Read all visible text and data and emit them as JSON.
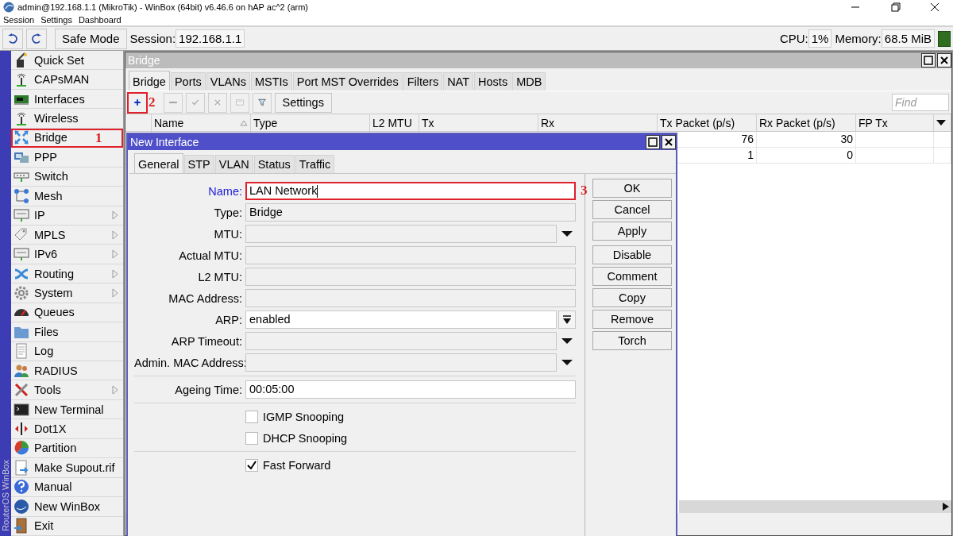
{
  "window": {
    "title": "admin@192.168.1.1 (MikroTik) - WinBox (64bit) v6.46.6 on hAP ac^2 (arm)"
  },
  "menu": [
    "Session",
    "Settings",
    "Dashboard"
  ],
  "toolbar": {
    "safe_mode": "Safe Mode",
    "session_label": "Session:",
    "session": "192.168.1.1",
    "cpu_label": "CPU:",
    "cpu": "1%",
    "memory_label": "Memory:",
    "memory": "68.5 MiB"
  },
  "sidebar": {
    "brand": "RouterOS WinBox",
    "items": [
      {
        "label": "Quick Set",
        "has_submenu": false,
        "highlighted": false
      },
      {
        "label": "CAPsMAN",
        "has_submenu": false,
        "highlighted": false
      },
      {
        "label": "Interfaces",
        "has_submenu": false,
        "highlighted": false
      },
      {
        "label": "Wireless",
        "has_submenu": false,
        "highlighted": false
      },
      {
        "label": "Bridge",
        "has_submenu": false,
        "highlighted": true,
        "annotation": "1"
      },
      {
        "label": "PPP",
        "has_submenu": false,
        "highlighted": false
      },
      {
        "label": "Switch",
        "has_submenu": false,
        "highlighted": false
      },
      {
        "label": "Mesh",
        "has_submenu": false,
        "highlighted": false
      },
      {
        "label": "IP",
        "has_submenu": true,
        "highlighted": false
      },
      {
        "label": "MPLS",
        "has_submenu": true,
        "highlighted": false
      },
      {
        "label": "IPv6",
        "has_submenu": true,
        "highlighted": false
      },
      {
        "label": "Routing",
        "has_submenu": true,
        "highlighted": false
      },
      {
        "label": "System",
        "has_submenu": true,
        "highlighted": false
      },
      {
        "label": "Queues",
        "has_submenu": false,
        "highlighted": false
      },
      {
        "label": "Files",
        "has_submenu": false,
        "highlighted": false
      },
      {
        "label": "Log",
        "has_submenu": false,
        "highlighted": false
      },
      {
        "label": "RADIUS",
        "has_submenu": false,
        "highlighted": false
      },
      {
        "label": "Tools",
        "has_submenu": true,
        "highlighted": false
      },
      {
        "label": "New Terminal",
        "has_submenu": false,
        "highlighted": false
      },
      {
        "label": "Dot1X",
        "has_submenu": false,
        "highlighted": false
      },
      {
        "label": "Partition",
        "has_submenu": false,
        "highlighted": false
      },
      {
        "label": "Make Supout.rif",
        "has_submenu": false,
        "highlighted": false
      },
      {
        "label": "Manual",
        "has_submenu": false,
        "highlighted": false
      },
      {
        "label": "New WinBox",
        "has_submenu": false,
        "highlighted": false
      },
      {
        "label": "Exit",
        "has_submenu": false,
        "highlighted": false
      }
    ]
  },
  "bridge_window": {
    "title": "Bridge",
    "tabs": [
      {
        "label": "Bridge",
        "selected": true
      },
      {
        "label": "Ports",
        "selected": false
      },
      {
        "label": "VLANs",
        "selected": false
      },
      {
        "label": "MSTIs",
        "selected": false
      },
      {
        "label": "Port MST Overrides",
        "selected": false
      },
      {
        "label": "Filters",
        "selected": false
      },
      {
        "label": "NAT",
        "selected": false
      },
      {
        "label": "Hosts",
        "selected": false
      },
      {
        "label": "MDB",
        "selected": false
      }
    ],
    "toolbar": [
      {
        "kind": "add",
        "disabled": false,
        "highlighted": true,
        "annotation": "2"
      },
      {
        "kind": "remove",
        "disabled": true,
        "highlighted": false
      },
      {
        "kind": "enable",
        "disabled": true,
        "highlighted": false
      },
      {
        "kind": "disable",
        "disabled": true,
        "highlighted": false
      },
      {
        "kind": "comment",
        "disabled": true,
        "highlighted": false
      },
      {
        "kind": "filter",
        "disabled": false,
        "highlighted": false
      },
      {
        "kind": "text",
        "label": "Settings",
        "disabled": false,
        "highlighted": false
      }
    ],
    "find": {
      "placeholder": "Find"
    },
    "table": {
      "columns": [
        "Name",
        "Type",
        "L2 MTU",
        "Tx",
        "Rx",
        "Tx Packet (p/s)",
        "Rx Packet (p/s)",
        "FP Tx"
      ],
      "rows": [
        {
          "tx_packet": "76",
          "rx_packet": "30"
        },
        {
          "tx_packet": "1",
          "rx_packet": "0"
        }
      ]
    }
  },
  "dialog": {
    "title": "New Interface",
    "tabs": [
      {
        "label": "General",
        "selected": true
      },
      {
        "label": "STP",
        "selected": false
      },
      {
        "label": "VLAN",
        "selected": false
      },
      {
        "label": "Status",
        "selected": false
      },
      {
        "label": "Traffic",
        "selected": false
      }
    ],
    "form": [
      {
        "kind": "field",
        "label": "Name:",
        "value": "LAN Network",
        "editable": true,
        "focused": true,
        "has_dropdown": false,
        "has_select_button": false,
        "highlighted": true,
        "annotation": "3"
      },
      {
        "kind": "field",
        "label": "Type:",
        "value": "Bridge",
        "editable": false,
        "focused": false,
        "has_dropdown": false,
        "has_select_button": false,
        "highlighted": false
      },
      {
        "kind": "field",
        "label": "MTU:",
        "editable": false,
        "focused": false,
        "has_dropdown": true,
        "has_select_button": false,
        "highlighted": false
      },
      {
        "kind": "field",
        "label": "Actual MTU:",
        "editable": false,
        "focused": false,
        "has_dropdown": false,
        "has_select_button": false,
        "highlighted": false
      },
      {
        "kind": "field",
        "label": "L2 MTU:",
        "editable": false,
        "focused": false,
        "has_dropdown": false,
        "has_select_button": false,
        "highlighted": false
      },
      {
        "kind": "field",
        "label": "MAC Address:",
        "editable": false,
        "focused": false,
        "has_dropdown": false,
        "has_select_button": false,
        "highlighted": false
      },
      {
        "kind": "field",
        "label": "ARP:",
        "value": "enabled",
        "editable": true,
        "focused": false,
        "has_dropdown": false,
        "has_select_button": true,
        "highlighted": false
      },
      {
        "kind": "field",
        "label": "ARP Timeout:",
        "editable": false,
        "focused": false,
        "has_dropdown": true,
        "has_select_button": false,
        "highlighted": false
      },
      {
        "kind": "field",
        "label": "Admin. MAC Address:",
        "editable": false,
        "focused": false,
        "has_dropdown": true,
        "has_select_button": false,
        "highlighted": false
      },
      {
        "kind": "separator"
      },
      {
        "kind": "field",
        "label": "Ageing Time:",
        "value": "00:05:00",
        "editable": true,
        "focused": false,
        "has_dropdown": false,
        "has_select_button": false,
        "highlighted": false
      },
      {
        "kind": "separator"
      },
      {
        "kind": "checkbox",
        "label": "IGMP Snooping",
        "checked": false
      },
      {
        "kind": "checkbox",
        "label": "DHCP Snooping",
        "checked": false
      },
      {
        "kind": "separator"
      },
      {
        "kind": "checkbox",
        "label": "Fast Forward",
        "checked": true
      }
    ],
    "buttons": [
      [
        "OK",
        "Cancel",
        "Apply"
      ],
      [
        "Disable",
        "Comment",
        "Copy",
        "Remove",
        "Torch"
      ]
    ]
  }
}
